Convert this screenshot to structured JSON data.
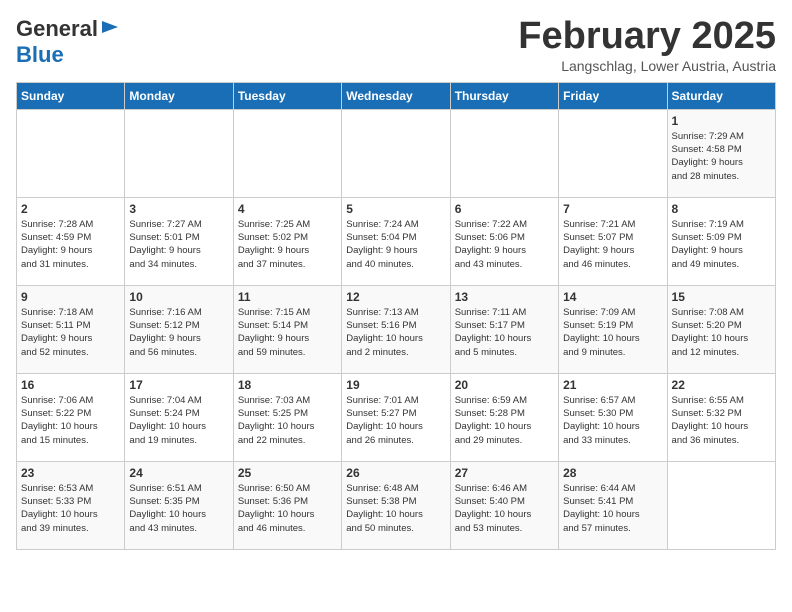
{
  "header": {
    "logo_line1": "General",
    "logo_line2": "Blue",
    "title": "February 2025",
    "subtitle": "Langschlag, Lower Austria, Austria"
  },
  "days_of_week": [
    "Sunday",
    "Monday",
    "Tuesday",
    "Wednesday",
    "Thursday",
    "Friday",
    "Saturday"
  ],
  "weeks": [
    [
      {
        "day": "",
        "info": ""
      },
      {
        "day": "",
        "info": ""
      },
      {
        "day": "",
        "info": ""
      },
      {
        "day": "",
        "info": ""
      },
      {
        "day": "",
        "info": ""
      },
      {
        "day": "",
        "info": ""
      },
      {
        "day": "1",
        "info": "Sunrise: 7:29 AM\nSunset: 4:58 PM\nDaylight: 9 hours\nand 28 minutes."
      }
    ],
    [
      {
        "day": "2",
        "info": "Sunrise: 7:28 AM\nSunset: 4:59 PM\nDaylight: 9 hours\nand 31 minutes."
      },
      {
        "day": "3",
        "info": "Sunrise: 7:27 AM\nSunset: 5:01 PM\nDaylight: 9 hours\nand 34 minutes."
      },
      {
        "day": "4",
        "info": "Sunrise: 7:25 AM\nSunset: 5:02 PM\nDaylight: 9 hours\nand 37 minutes."
      },
      {
        "day": "5",
        "info": "Sunrise: 7:24 AM\nSunset: 5:04 PM\nDaylight: 9 hours\nand 40 minutes."
      },
      {
        "day": "6",
        "info": "Sunrise: 7:22 AM\nSunset: 5:06 PM\nDaylight: 9 hours\nand 43 minutes."
      },
      {
        "day": "7",
        "info": "Sunrise: 7:21 AM\nSunset: 5:07 PM\nDaylight: 9 hours\nand 46 minutes."
      },
      {
        "day": "8",
        "info": "Sunrise: 7:19 AM\nSunset: 5:09 PM\nDaylight: 9 hours\nand 49 minutes."
      }
    ],
    [
      {
        "day": "9",
        "info": "Sunrise: 7:18 AM\nSunset: 5:11 PM\nDaylight: 9 hours\nand 52 minutes."
      },
      {
        "day": "10",
        "info": "Sunrise: 7:16 AM\nSunset: 5:12 PM\nDaylight: 9 hours\nand 56 minutes."
      },
      {
        "day": "11",
        "info": "Sunrise: 7:15 AM\nSunset: 5:14 PM\nDaylight: 9 hours\nand 59 minutes."
      },
      {
        "day": "12",
        "info": "Sunrise: 7:13 AM\nSunset: 5:16 PM\nDaylight: 10 hours\nand 2 minutes."
      },
      {
        "day": "13",
        "info": "Sunrise: 7:11 AM\nSunset: 5:17 PM\nDaylight: 10 hours\nand 5 minutes."
      },
      {
        "day": "14",
        "info": "Sunrise: 7:09 AM\nSunset: 5:19 PM\nDaylight: 10 hours\nand 9 minutes."
      },
      {
        "day": "15",
        "info": "Sunrise: 7:08 AM\nSunset: 5:20 PM\nDaylight: 10 hours\nand 12 minutes."
      }
    ],
    [
      {
        "day": "16",
        "info": "Sunrise: 7:06 AM\nSunset: 5:22 PM\nDaylight: 10 hours\nand 15 minutes."
      },
      {
        "day": "17",
        "info": "Sunrise: 7:04 AM\nSunset: 5:24 PM\nDaylight: 10 hours\nand 19 minutes."
      },
      {
        "day": "18",
        "info": "Sunrise: 7:03 AM\nSunset: 5:25 PM\nDaylight: 10 hours\nand 22 minutes."
      },
      {
        "day": "19",
        "info": "Sunrise: 7:01 AM\nSunset: 5:27 PM\nDaylight: 10 hours\nand 26 minutes."
      },
      {
        "day": "20",
        "info": "Sunrise: 6:59 AM\nSunset: 5:28 PM\nDaylight: 10 hours\nand 29 minutes."
      },
      {
        "day": "21",
        "info": "Sunrise: 6:57 AM\nSunset: 5:30 PM\nDaylight: 10 hours\nand 33 minutes."
      },
      {
        "day": "22",
        "info": "Sunrise: 6:55 AM\nSunset: 5:32 PM\nDaylight: 10 hours\nand 36 minutes."
      }
    ],
    [
      {
        "day": "23",
        "info": "Sunrise: 6:53 AM\nSunset: 5:33 PM\nDaylight: 10 hours\nand 39 minutes."
      },
      {
        "day": "24",
        "info": "Sunrise: 6:51 AM\nSunset: 5:35 PM\nDaylight: 10 hours\nand 43 minutes."
      },
      {
        "day": "25",
        "info": "Sunrise: 6:50 AM\nSunset: 5:36 PM\nDaylight: 10 hours\nand 46 minutes."
      },
      {
        "day": "26",
        "info": "Sunrise: 6:48 AM\nSunset: 5:38 PM\nDaylight: 10 hours\nand 50 minutes."
      },
      {
        "day": "27",
        "info": "Sunrise: 6:46 AM\nSunset: 5:40 PM\nDaylight: 10 hours\nand 53 minutes."
      },
      {
        "day": "28",
        "info": "Sunrise: 6:44 AM\nSunset: 5:41 PM\nDaylight: 10 hours\nand 57 minutes."
      },
      {
        "day": "",
        "info": ""
      }
    ]
  ]
}
